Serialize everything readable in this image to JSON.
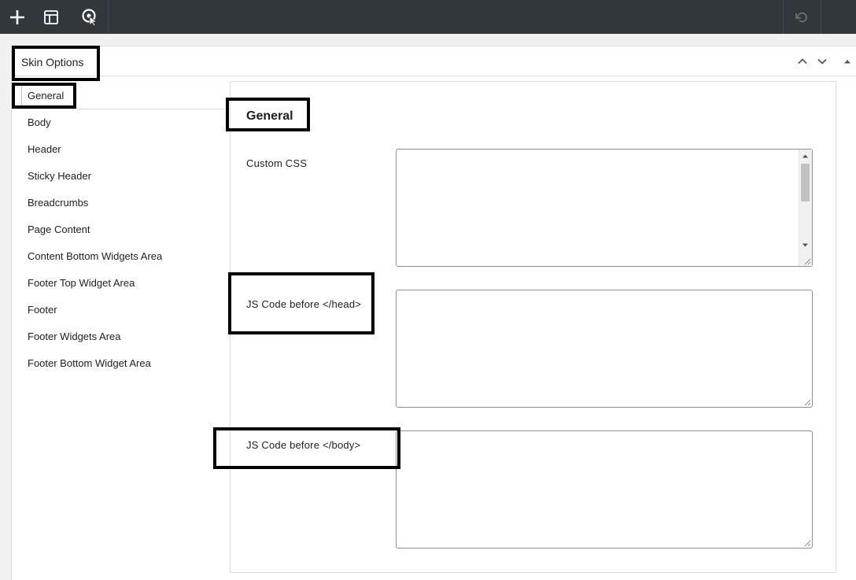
{
  "toolbar": {
    "icons": [
      "plus-icon",
      "layout-icon",
      "target-cursor-icon",
      "undo-icon"
    ]
  },
  "panel": {
    "title": "Skin Options"
  },
  "tabs": [
    {
      "label": "General",
      "active": true
    },
    {
      "label": "Body"
    },
    {
      "label": "Header"
    },
    {
      "label": "Sticky Header"
    },
    {
      "label": "Breadcrumbs"
    },
    {
      "label": "Page Content"
    },
    {
      "label": "Content Bottom Widgets Area"
    },
    {
      "label": "Footer Top Widget Area"
    },
    {
      "label": "Footer"
    },
    {
      "label": "Footer Widgets Area"
    },
    {
      "label": "Footer Bottom Widget Area"
    }
  ],
  "content": {
    "title": "General",
    "fields": [
      {
        "label": "Custom CSS",
        "value": ""
      },
      {
        "label": "JS Code before </head>",
        "value": ""
      },
      {
        "label": "JS Code before </body>",
        "value": ""
      }
    ]
  },
  "colors": {
    "toolbar_bg": "#32373c",
    "highlight_border": "#000000"
  }
}
